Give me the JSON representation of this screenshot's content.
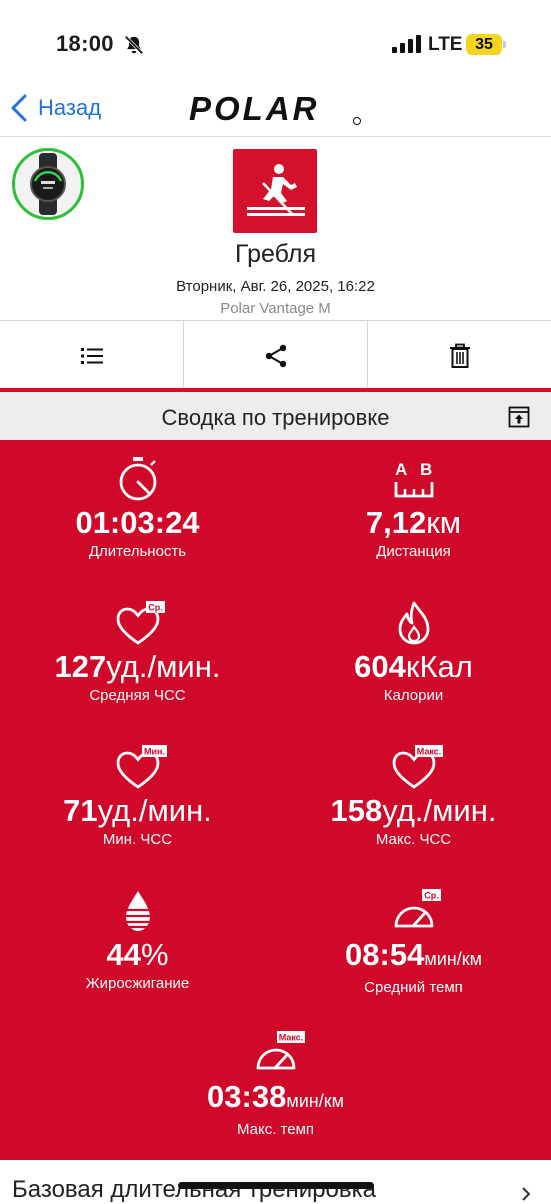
{
  "status": {
    "time": "18:00",
    "network": "LTE",
    "battery": "35"
  },
  "nav": {
    "back_label": "Назад"
  },
  "header": {
    "sport_name": "Гребля",
    "date": "Вторник, Авг. 26, 2025, 16:22",
    "device_model": "Polar Vantage M"
  },
  "summary": {
    "title": "Сводка по тренировке"
  },
  "stats": [
    {
      "value": "01:03:24",
      "unit": "",
      "label": "Длительность",
      "badge": ""
    },
    {
      "value": "7,12",
      "unit": "км",
      "label": "Дистанция",
      "badge": ""
    },
    {
      "value": "127",
      "unit": "уд./мин.",
      "label": "Средняя ЧСС",
      "badge": "Ср."
    },
    {
      "value": "604",
      "unit": "кКал",
      "label": "Калории",
      "badge": ""
    },
    {
      "value": "71",
      "unit": "уд./мин.",
      "label": "Мин. ЧСС",
      "badge": "Мин."
    },
    {
      "value": "158",
      "unit": "уд./мин.",
      "label": "Макс. ЧСС",
      "badge": "Макс."
    },
    {
      "value": "44",
      "unit": "%",
      "label": "Жиросжигание",
      "badge": ""
    },
    {
      "value": "08:54",
      "unit": "мин/км",
      "label": "Средний темп",
      "badge": "Ср."
    },
    {
      "value": "03:38",
      "unit": "мин/км",
      "label": "Макс. темп",
      "badge": "Макс."
    }
  ],
  "distance_icon_letters": {
    "a": "A",
    "b": "B"
  },
  "bottom": {
    "section_title": "Базовая длительная тренировка"
  },
  "colors": {
    "brand_red": "#d0092a",
    "link_blue": "#1f72d6",
    "device_ring": "#2fbf3b"
  }
}
